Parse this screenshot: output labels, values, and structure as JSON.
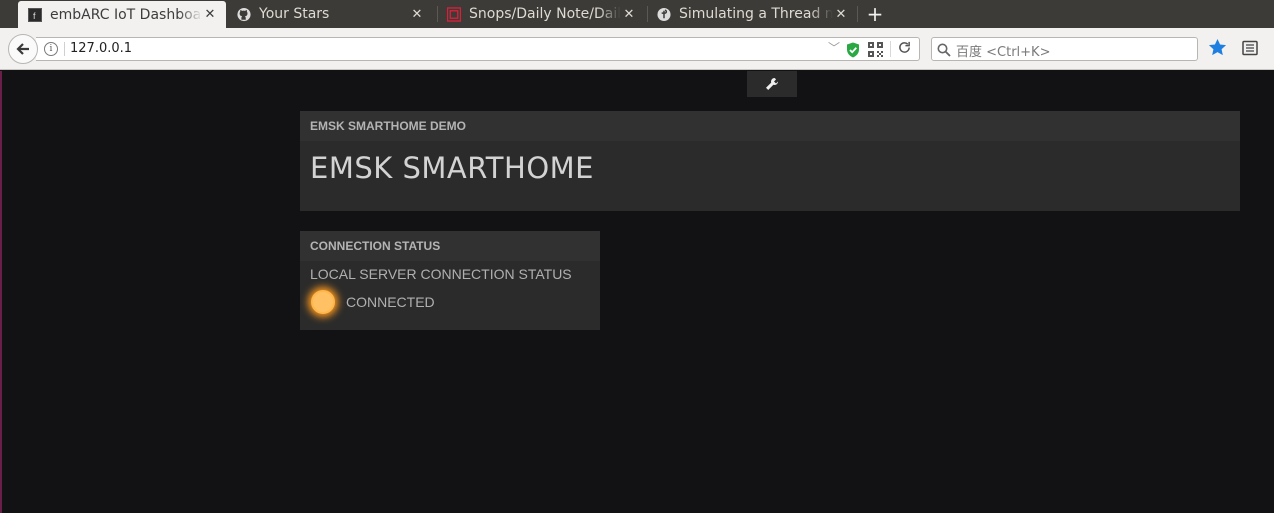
{
  "browser": {
    "tabs": [
      {
        "title": "embARC IoT Dashboard",
        "active": true,
        "favicon": "framed-f-icon"
      },
      {
        "title": "Your Stars",
        "active": false,
        "favicon": "github-icon"
      },
      {
        "title": "Snops/Daily Note/Daily",
        "active": false,
        "favicon": "red-app-icon"
      },
      {
        "title": "Simulating a Thread network",
        "active": false,
        "favicon": "thread-icon"
      }
    ],
    "url": "127.0.0.1",
    "search_placeholder": "百度 <Ctrl+K>",
    "colors": {
      "accent_star": "#1f7fe0",
      "shield": "#2aa843"
    }
  },
  "page": {
    "toolbar_icon": "wrench-icon",
    "panes": {
      "demo": {
        "header": "EMSK SMARTHOME DEMO",
        "title": "EMSK SMARTHOME"
      },
      "connection": {
        "header": "CONNECTION STATUS",
        "label": "LOCAL SERVER CONNECTION STATUS",
        "state": "CONNECTED",
        "indicator_color": "#ffc163"
      }
    }
  }
}
